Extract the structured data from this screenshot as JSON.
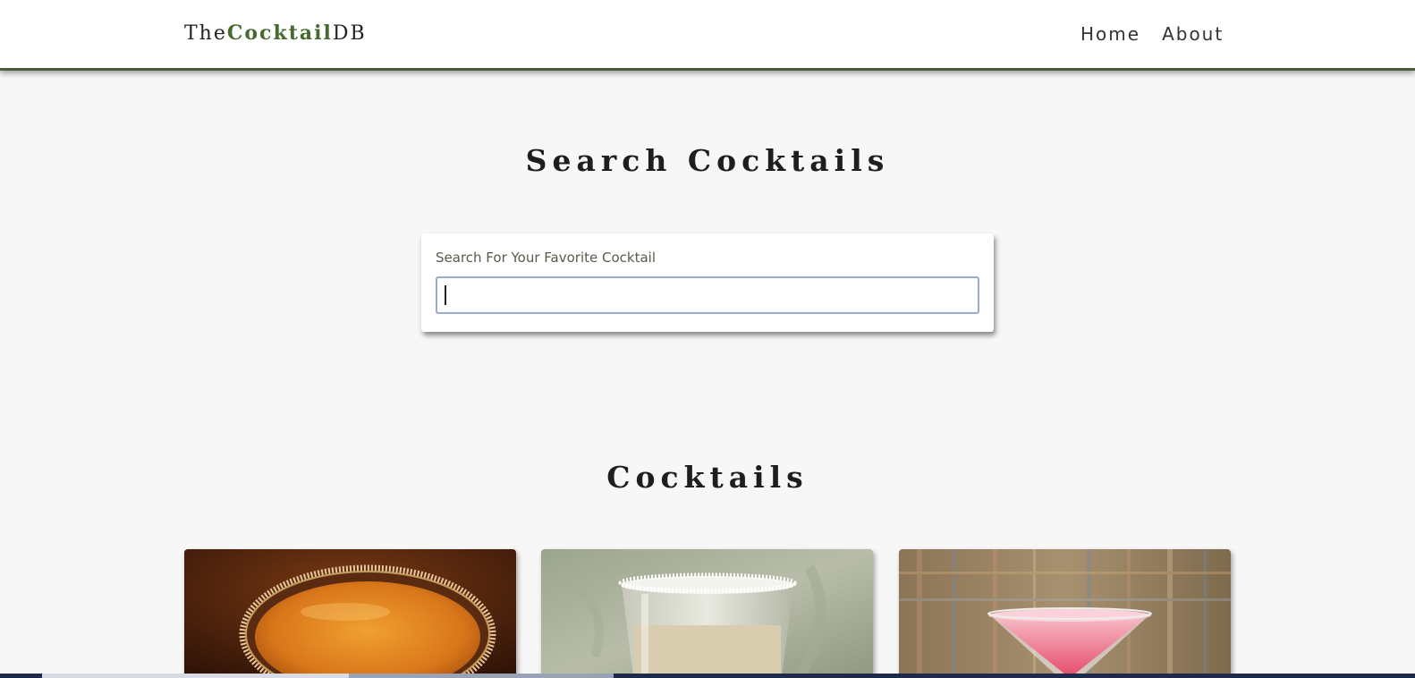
{
  "navbar": {
    "logo": {
      "prefix": "The",
      "accent": "Cocktail",
      "suffix": "DB"
    },
    "links": [
      {
        "label": "Home"
      },
      {
        "label": "About"
      }
    ],
    "border_color": "#4b5b3c"
  },
  "search": {
    "heading": "Search Cocktails",
    "label": "Search For Your Favorite Cocktail",
    "value": "",
    "placeholder": ""
  },
  "cocktails": {
    "heading": "Cocktails",
    "cards": [
      {
        "image": "amber-martini-sugar-rim-image"
      },
      {
        "image": "cream-cocktail-salt-rim-image"
      },
      {
        "image": "pink-martini-image"
      }
    ]
  },
  "colors": {
    "accent": "#476a30",
    "background": "#f7f7f7",
    "input_border": "#9aacce"
  }
}
